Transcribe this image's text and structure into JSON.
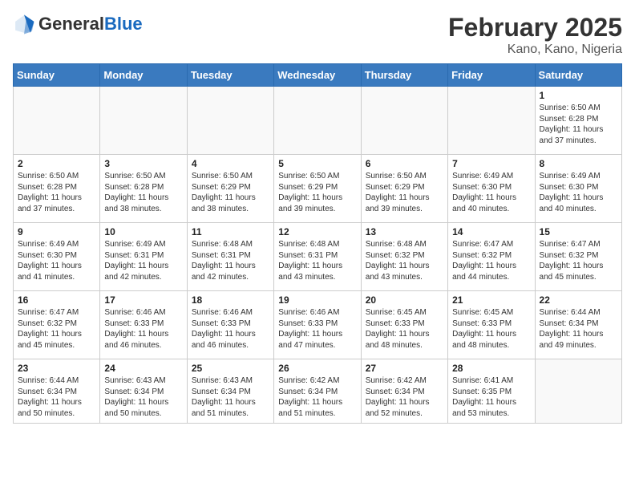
{
  "header": {
    "logo_general": "General",
    "logo_blue": "Blue",
    "title": "February 2025",
    "location": "Kano, Kano, Nigeria"
  },
  "weekdays": [
    "Sunday",
    "Monday",
    "Tuesday",
    "Wednesday",
    "Thursday",
    "Friday",
    "Saturday"
  ],
  "weeks": [
    [
      {
        "day": "",
        "info": ""
      },
      {
        "day": "",
        "info": ""
      },
      {
        "day": "",
        "info": ""
      },
      {
        "day": "",
        "info": ""
      },
      {
        "day": "",
        "info": ""
      },
      {
        "day": "",
        "info": ""
      },
      {
        "day": "1",
        "info": "Sunrise: 6:50 AM\nSunset: 6:28 PM\nDaylight: 11 hours\nand 37 minutes."
      }
    ],
    [
      {
        "day": "2",
        "info": "Sunrise: 6:50 AM\nSunset: 6:28 PM\nDaylight: 11 hours\nand 37 minutes."
      },
      {
        "day": "3",
        "info": "Sunrise: 6:50 AM\nSunset: 6:28 PM\nDaylight: 11 hours\nand 38 minutes."
      },
      {
        "day": "4",
        "info": "Sunrise: 6:50 AM\nSunset: 6:29 PM\nDaylight: 11 hours\nand 38 minutes."
      },
      {
        "day": "5",
        "info": "Sunrise: 6:50 AM\nSunset: 6:29 PM\nDaylight: 11 hours\nand 39 minutes."
      },
      {
        "day": "6",
        "info": "Sunrise: 6:50 AM\nSunset: 6:29 PM\nDaylight: 11 hours\nand 39 minutes."
      },
      {
        "day": "7",
        "info": "Sunrise: 6:49 AM\nSunset: 6:30 PM\nDaylight: 11 hours\nand 40 minutes."
      },
      {
        "day": "8",
        "info": "Sunrise: 6:49 AM\nSunset: 6:30 PM\nDaylight: 11 hours\nand 40 minutes."
      }
    ],
    [
      {
        "day": "9",
        "info": "Sunrise: 6:49 AM\nSunset: 6:30 PM\nDaylight: 11 hours\nand 41 minutes."
      },
      {
        "day": "10",
        "info": "Sunrise: 6:49 AM\nSunset: 6:31 PM\nDaylight: 11 hours\nand 42 minutes."
      },
      {
        "day": "11",
        "info": "Sunrise: 6:48 AM\nSunset: 6:31 PM\nDaylight: 11 hours\nand 42 minutes."
      },
      {
        "day": "12",
        "info": "Sunrise: 6:48 AM\nSunset: 6:31 PM\nDaylight: 11 hours\nand 43 minutes."
      },
      {
        "day": "13",
        "info": "Sunrise: 6:48 AM\nSunset: 6:32 PM\nDaylight: 11 hours\nand 43 minutes."
      },
      {
        "day": "14",
        "info": "Sunrise: 6:47 AM\nSunset: 6:32 PM\nDaylight: 11 hours\nand 44 minutes."
      },
      {
        "day": "15",
        "info": "Sunrise: 6:47 AM\nSunset: 6:32 PM\nDaylight: 11 hours\nand 45 minutes."
      }
    ],
    [
      {
        "day": "16",
        "info": "Sunrise: 6:47 AM\nSunset: 6:32 PM\nDaylight: 11 hours\nand 45 minutes."
      },
      {
        "day": "17",
        "info": "Sunrise: 6:46 AM\nSunset: 6:33 PM\nDaylight: 11 hours\nand 46 minutes."
      },
      {
        "day": "18",
        "info": "Sunrise: 6:46 AM\nSunset: 6:33 PM\nDaylight: 11 hours\nand 46 minutes."
      },
      {
        "day": "19",
        "info": "Sunrise: 6:46 AM\nSunset: 6:33 PM\nDaylight: 11 hours\nand 47 minutes."
      },
      {
        "day": "20",
        "info": "Sunrise: 6:45 AM\nSunset: 6:33 PM\nDaylight: 11 hours\nand 48 minutes."
      },
      {
        "day": "21",
        "info": "Sunrise: 6:45 AM\nSunset: 6:33 PM\nDaylight: 11 hours\nand 48 minutes."
      },
      {
        "day": "22",
        "info": "Sunrise: 6:44 AM\nSunset: 6:34 PM\nDaylight: 11 hours\nand 49 minutes."
      }
    ],
    [
      {
        "day": "23",
        "info": "Sunrise: 6:44 AM\nSunset: 6:34 PM\nDaylight: 11 hours\nand 50 minutes."
      },
      {
        "day": "24",
        "info": "Sunrise: 6:43 AM\nSunset: 6:34 PM\nDaylight: 11 hours\nand 50 minutes."
      },
      {
        "day": "25",
        "info": "Sunrise: 6:43 AM\nSunset: 6:34 PM\nDaylight: 11 hours\nand 51 minutes."
      },
      {
        "day": "26",
        "info": "Sunrise: 6:42 AM\nSunset: 6:34 PM\nDaylight: 11 hours\nand 51 minutes."
      },
      {
        "day": "27",
        "info": "Sunrise: 6:42 AM\nSunset: 6:34 PM\nDaylight: 11 hours\nand 52 minutes."
      },
      {
        "day": "28",
        "info": "Sunrise: 6:41 AM\nSunset: 6:35 PM\nDaylight: 11 hours\nand 53 minutes."
      },
      {
        "day": "",
        "info": ""
      }
    ]
  ]
}
